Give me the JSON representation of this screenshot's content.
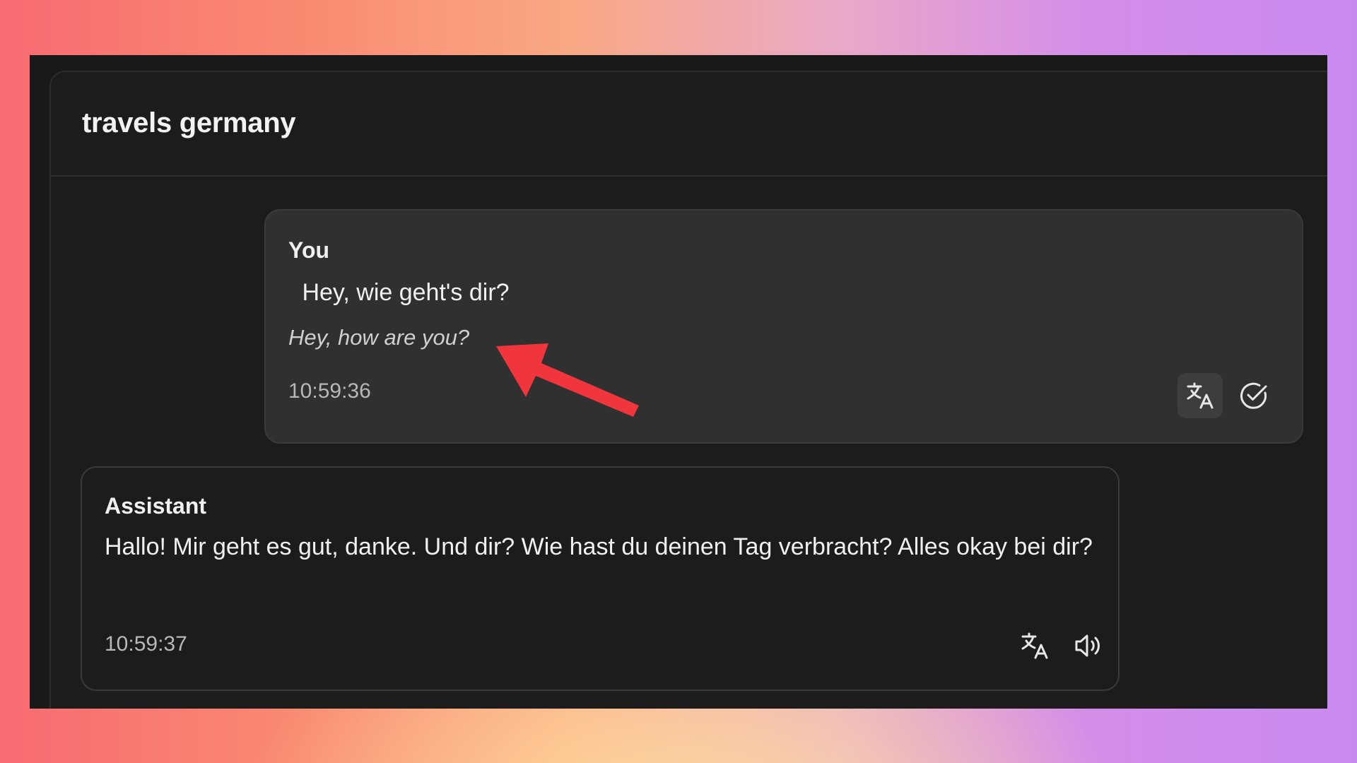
{
  "chat": {
    "title": "travels germany"
  },
  "messages": [
    {
      "role": "You",
      "text": " Hey, wie geht's dir?",
      "translation": "Hey, how are you?",
      "time": "10:59:36",
      "actions": [
        "translate-icon",
        "check-circle-icon"
      ]
    },
    {
      "role": "Assistant",
      "text": "Hallo! Mir geht es gut, danke. Und dir? Wie hast du deinen Tag verbracht? Alles okay bei dir?",
      "time": "10:59:37",
      "actions": [
        "translate-icon",
        "speaker-icon"
      ]
    }
  ],
  "colors": {
    "panel_bg": "#1c1c1c",
    "user_bubble_bg": "#303030",
    "annotation_arrow": "#f0363c"
  }
}
